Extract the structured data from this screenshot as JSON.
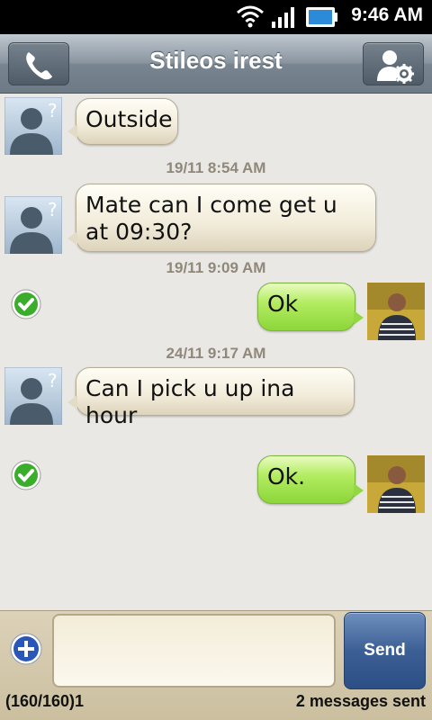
{
  "status_bar": {
    "time": "9:46 AM",
    "icons": [
      "wifi-icon",
      "signal-icon",
      "battery-icon"
    ]
  },
  "header": {
    "title": "Stileos irest",
    "left_button_icon": "phone-icon",
    "right_button_icon": "contact-settings-icon"
  },
  "messages": [
    {
      "direction": "incoming",
      "text": "Outside",
      "timestamp": ""
    },
    {
      "direction": "incoming",
      "text": "Mate can I come get u at 09:30?",
      "timestamp": "19/11 8:54 AM"
    },
    {
      "direction": "outgoing",
      "text": "Ok",
      "timestamp": "19/11 9:09 AM",
      "delivered": true
    },
    {
      "direction": "incoming",
      "text": "Can I pick u up ina hour",
      "timestamp": "24/11 9:17 AM"
    },
    {
      "direction": "outgoing",
      "text": "Ok.",
      "timestamp": "",
      "delivered": true
    }
  ],
  "composer": {
    "input_value": "",
    "send_label": "Send",
    "char_count": "(160/160)1",
    "status": "2 messages sent"
  },
  "colors": {
    "incoming_bubble": "#f1ebd9",
    "outgoing_bubble": "#b4ec62",
    "send_button": "#3c5f95",
    "timestamp_text": "#8f887b"
  }
}
